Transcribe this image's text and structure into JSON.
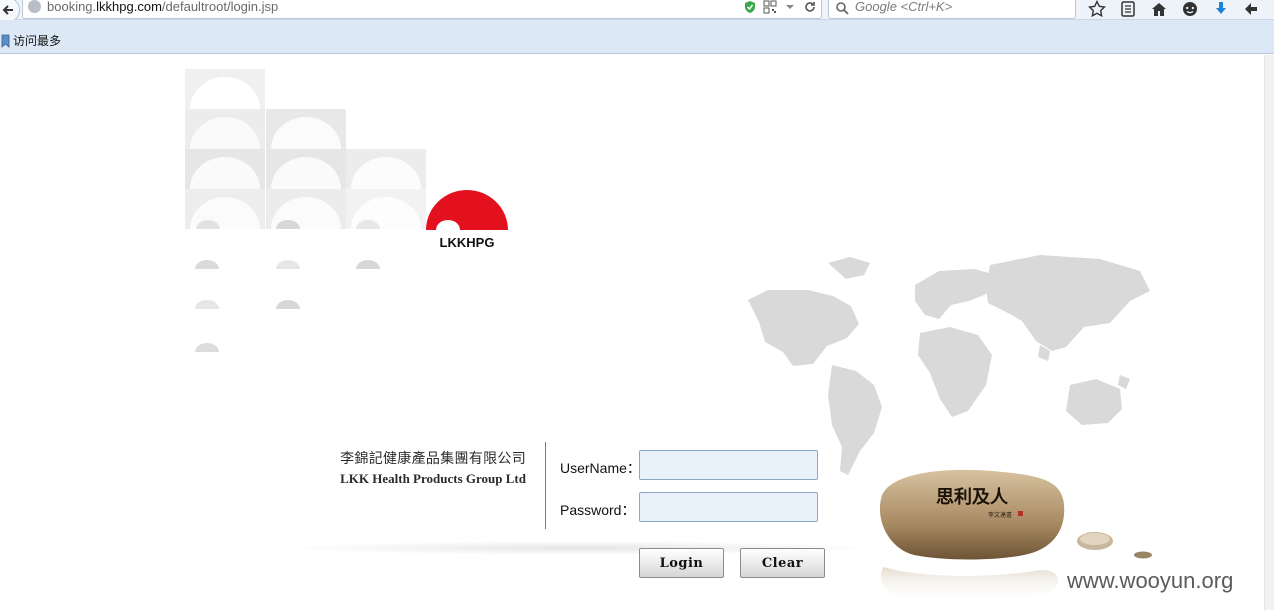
{
  "browser": {
    "url_prefix": "booking.",
    "url_domain": "lkkhpg.com",
    "url_path": "/defaultroot/login.jsp",
    "search_placeholder": "Google <Ctrl+K>",
    "bookmark_label": "访问最多"
  },
  "logo": {
    "text": "LKKHPG",
    "brand_color": "#e3101e"
  },
  "company": {
    "name_cn": "李錦記健康產品集團有限公司",
    "name_en": "LKK Health Products Group Ltd"
  },
  "login": {
    "username_label": "UserName：",
    "username_value": "",
    "password_label": "Password：",
    "password_value": "",
    "login_button": "Login",
    "clear_button": "Clear"
  },
  "decoration": {
    "stone_calligraphy": "思利及人",
    "stone_signature": "李文達書"
  },
  "watermark": "www.wooyun.org",
  "colors": {
    "input_bg": "#e9f2fb",
    "input_border": "#8aa8c4",
    "bookmarks_bg": "#dce8f5"
  }
}
